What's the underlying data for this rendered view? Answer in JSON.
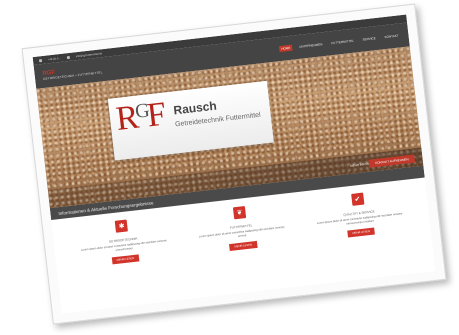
{
  "topbar": {
    "phone": "+49 (0) 5…",
    "email": "info@rgf-futtermittel.de"
  },
  "header": {
    "brand_name": "RGF",
    "brand_tagline": "GETREIDETECHNIK • FUTTERMITTEL",
    "nav": [
      "HOME",
      "UNTERNEHMEN",
      "FUTTERMITTEL",
      "SERVICE",
      "KONTAKT"
    ]
  },
  "hero": {
    "logo_letters": "R",
    "logo_letters_2": "G",
    "logo_letters_3": "F",
    "logo_title": "Rausch",
    "logo_subtitle": "Getreidetechnik   Futtermittel",
    "more_link": "MEHR INFOS",
    "contact_button": "KONTAKT AUFNEHMEN"
  },
  "info_bar": {
    "text": "Informationen & Aktuelle Forschungsergebnisse"
  },
  "features": [
    {
      "icon": "gear-icon",
      "glyph": "✱",
      "title": "GETREIDETECHNIK",
      "description": "Lorem ipsum dolor sit amet consetetur sadipscing elitr sed diam nonumy eirmod tempor",
      "button": "MEHR LESEN"
    },
    {
      "icon": "leaf-icon",
      "glyph": "❦",
      "title": "FUTTERMITTEL",
      "description": "Lorem ipsum dolor sit amet consetetur sadipscing elitr sed diam nonumy eirmod",
      "button": "MEHR LESEN"
    },
    {
      "icon": "checkmark-icon",
      "glyph": "✔",
      "title": "QUALITÄT & SERVICE",
      "description": "Lorem ipsum dolor sit amet consetetur sadipscing elitr sed diam nonumy eirmod tempor invidunt",
      "button": "MEHR LESEN"
    }
  ],
  "colors": {
    "accent": "#d0342a",
    "header": "#444444",
    "topbar": "#3b3b3b"
  }
}
